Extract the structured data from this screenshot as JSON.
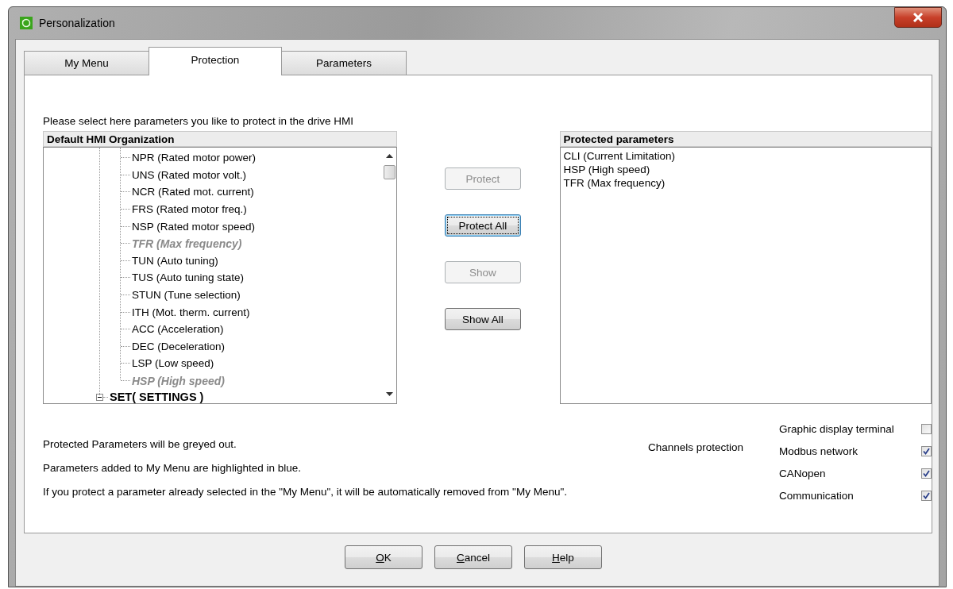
{
  "window": {
    "title": "Personalization"
  },
  "tabs": [
    {
      "label": "My Menu",
      "selected": false
    },
    {
      "label": "Protection",
      "selected": true
    },
    {
      "label": "Parameters",
      "selected": false
    }
  ],
  "instruction": "Please select here parameters you like to protect in the drive HMI",
  "tree": {
    "header": "Default HMI Organization",
    "items": [
      {
        "label": "NPR (Rated motor power)",
        "protected": false
      },
      {
        "label": "UNS (Rated motor volt.)",
        "protected": false
      },
      {
        "label": "NCR (Rated mot. current)",
        "protected": false
      },
      {
        "label": "FRS (Rated motor freq.)",
        "protected": false
      },
      {
        "label": "NSP (Rated motor speed)",
        "protected": false
      },
      {
        "label": "TFR (Max frequency)",
        "protected": true
      },
      {
        "label": "TUN (Auto tuning)",
        "protected": false
      },
      {
        "label": "TUS (Auto tuning state)",
        "protected": false
      },
      {
        "label": "STUN (Tune selection)",
        "protected": false
      },
      {
        "label": "ITH (Mot. therm. current)",
        "protected": false
      },
      {
        "label": "ACC (Acceleration)",
        "protected": false
      },
      {
        "label": "DEC (Deceleration)",
        "protected": false
      },
      {
        "label": "LSP (Low speed)",
        "protected": false
      },
      {
        "label": "HSP (High speed)",
        "protected": true
      }
    ],
    "next_node": {
      "label": "SET( SETTINGS )",
      "expanded": true
    }
  },
  "actions": [
    {
      "label": "Protect",
      "disabled": true,
      "focused": false
    },
    {
      "label": "Protect All",
      "disabled": false,
      "focused": true
    },
    {
      "label": "Show",
      "disabled": true,
      "focused": false
    },
    {
      "label": "Show All",
      "disabled": false,
      "focused": false
    }
  ],
  "protected_list": {
    "header": "Protected parameters",
    "items": [
      "CLI (Current Limitation)",
      "HSP (High speed)",
      "TFR (Max frequency)"
    ]
  },
  "notes": [
    "Protected Parameters will be greyed out.",
    "Parameters added to My Menu are highlighted in blue.",
    "If you protect a parameter already selected in the \"My Menu\", it will be automatically removed from \"My Menu\"."
  ],
  "channels": {
    "label": "Channels protection",
    "items": [
      {
        "label": "Graphic display terminal",
        "checked": false
      },
      {
        "label": "Modbus network",
        "checked": true
      },
      {
        "label": "CANopen",
        "checked": true
      },
      {
        "label": "Communication",
        "checked": true
      }
    ]
  },
  "buttons": [
    "OK",
    "Cancel",
    "Help"
  ]
}
